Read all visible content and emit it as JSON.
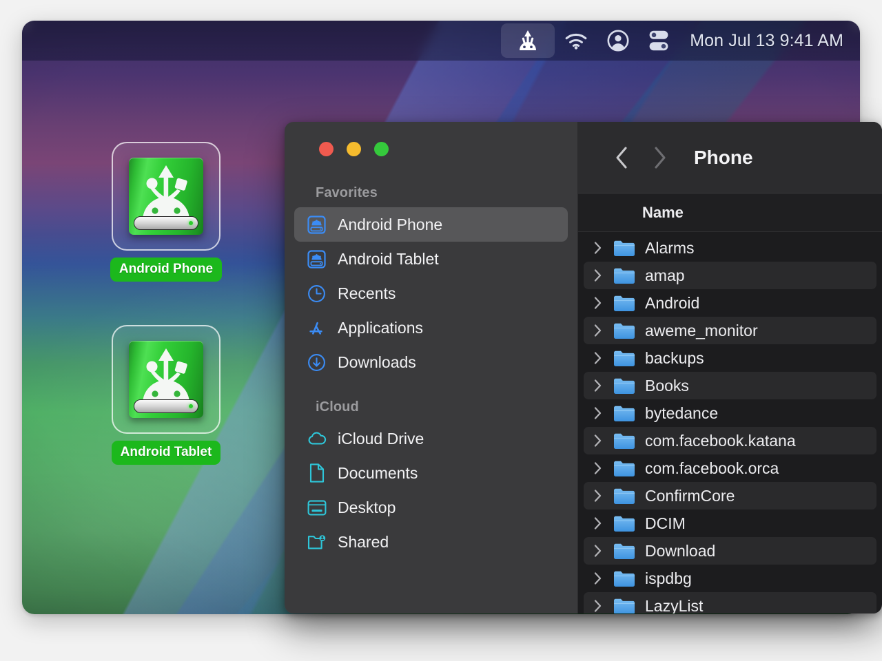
{
  "menubar": {
    "items": [
      {
        "name": "android-file-transfer-icon",
        "label": "Android File Transfer",
        "active": true
      },
      {
        "name": "wifi-icon",
        "label": "Wi-Fi",
        "active": false
      },
      {
        "name": "user-account-icon",
        "label": "Account",
        "active": false
      },
      {
        "name": "control-center-icon",
        "label": "Control Center",
        "active": false
      }
    ],
    "clock": "Mon Jul 13  9:41 AM"
  },
  "desktop": {
    "icons": [
      {
        "label": "Android Phone",
        "icon": "android-drive-icon"
      },
      {
        "label": "Android Tablet",
        "icon": "android-drive-icon"
      }
    ]
  },
  "finder": {
    "window_controls": {
      "close": "Close",
      "minimize": "Minimize",
      "zoom": "Zoom"
    },
    "sidebar": {
      "sections": [
        {
          "title": "Favorites",
          "items": [
            {
              "label": "Android Phone",
              "icon": "android-drive-icon",
              "selected": true
            },
            {
              "label": "Android Tablet",
              "icon": "android-drive-icon",
              "selected": false
            },
            {
              "label": "Recents",
              "icon": "clock-icon",
              "selected": false
            },
            {
              "label": "Applications",
              "icon": "app-store-icon",
              "selected": false
            },
            {
              "label": "Downloads",
              "icon": "download-arrow-icon",
              "selected": false
            }
          ]
        },
        {
          "title": "iCloud",
          "items": [
            {
              "label": "iCloud Drive",
              "icon": "cloud-icon",
              "selected": false
            },
            {
              "label": "Documents",
              "icon": "document-icon",
              "selected": false
            },
            {
              "label": "Desktop",
              "icon": "desktop-icon",
              "selected": false
            },
            {
              "label": "Shared",
              "icon": "shared-folder-icon",
              "selected": false
            }
          ]
        }
      ]
    },
    "toolbar": {
      "back_label": "Back",
      "forward_label": "Forward",
      "title": "Phone"
    },
    "columns": [
      "Name"
    ],
    "files": [
      {
        "name": "Alarms",
        "type": "folder",
        "expandable": true
      },
      {
        "name": "amap",
        "type": "folder",
        "expandable": true
      },
      {
        "name": "Android",
        "type": "folder",
        "expandable": true
      },
      {
        "name": "aweme_monitor",
        "type": "folder",
        "expandable": true
      },
      {
        "name": "backups",
        "type": "folder",
        "expandable": true
      },
      {
        "name": "Books",
        "type": "folder",
        "expandable": true
      },
      {
        "name": "bytedance",
        "type": "folder",
        "expandable": true
      },
      {
        "name": "com.facebook.katana",
        "type": "folder",
        "expandable": true
      },
      {
        "name": "com.facebook.orca",
        "type": "folder",
        "expandable": true
      },
      {
        "name": "ConfirmCore",
        "type": "folder",
        "expandable": true
      },
      {
        "name": "DCIM",
        "type": "folder",
        "expandable": true
      },
      {
        "name": "Download",
        "type": "folder",
        "expandable": true
      },
      {
        "name": "ispdbg",
        "type": "folder",
        "expandable": true
      },
      {
        "name": "LazyList",
        "type": "folder",
        "expandable": true
      }
    ]
  },
  "colors": {
    "accent_blue": "#3b8cf5",
    "icloud_cyan": "#2ec6d9",
    "drive_green": "#1cb81c",
    "sidebar_bg": "#3a3a3c",
    "content_bg": "#1c1c1e",
    "traffic_red": "#f05a4f",
    "traffic_yellow": "#f5bb2e",
    "traffic_green": "#35c93c"
  }
}
